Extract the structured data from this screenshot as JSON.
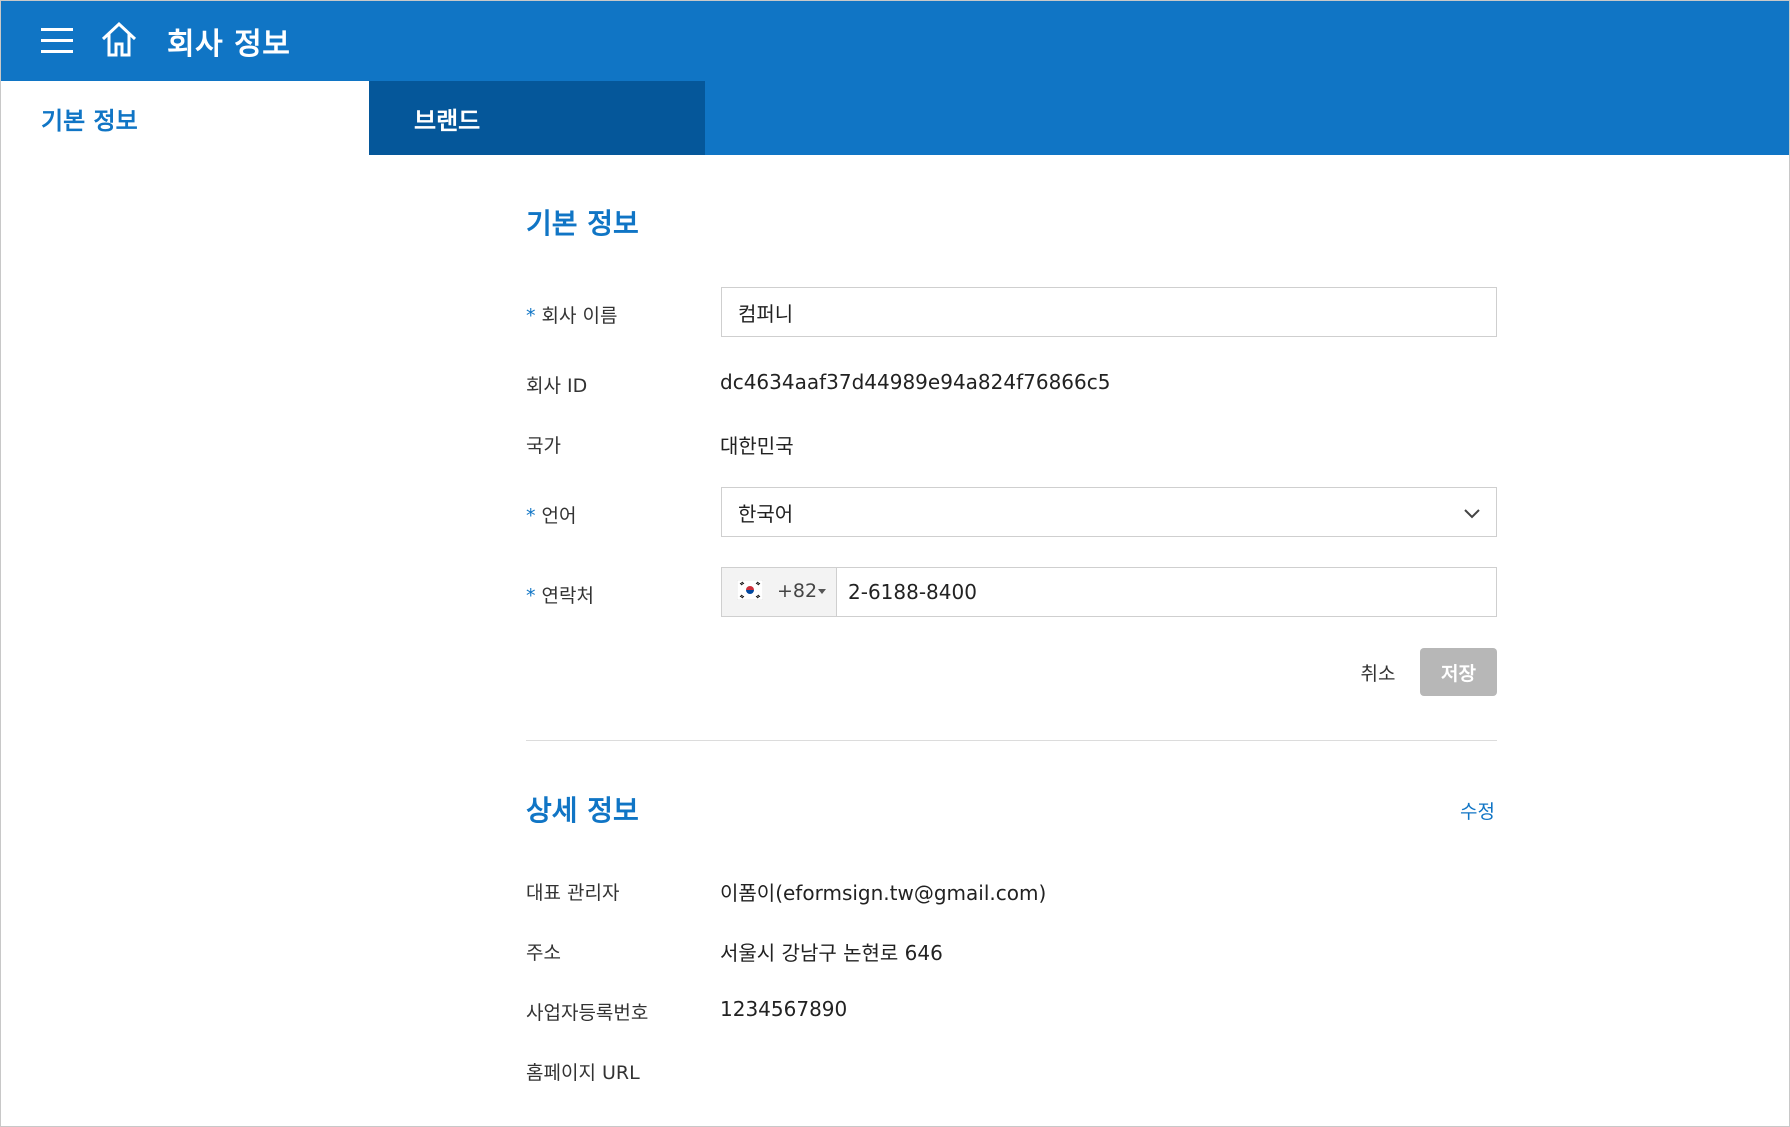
{
  "header": {
    "title": "회사 정보",
    "menu_icon": "hamburger-menu-icon",
    "home_icon": "home-icon"
  },
  "tabs": [
    {
      "label": "기본 정보",
      "active": true
    },
    {
      "label": "브랜드",
      "active": false
    }
  ],
  "basic_info": {
    "title": "기본 정보",
    "required_mark": "*",
    "company_name": {
      "label": "회사 이름",
      "value": "컴퍼니"
    },
    "company_id": {
      "label": "회사 ID",
      "value": "dc4634aaf37d44989e94a824f76866c5"
    },
    "country": {
      "label": "국가",
      "value": "대한민국"
    },
    "language": {
      "label": "언어",
      "value": "한국어"
    },
    "contact": {
      "label": "연락처",
      "country_code": "+82",
      "number": "2-6188-8400",
      "flag_icon": "korea-flag-icon"
    },
    "cancel_label": "취소",
    "save_label": "저장"
  },
  "detail_info": {
    "title": "상세 정보",
    "edit_label": "수정",
    "representative_admin": {
      "label": "대표 관리자",
      "value": "이폼이(eformsign.tw@gmail.com)"
    },
    "address": {
      "label": "주소",
      "value": "서울시 강남구 논현로 646"
    },
    "business_number": {
      "label": "사업자등록번호",
      "value": "1234567890"
    },
    "homepage_url": {
      "label": "홈페이지 URL",
      "value": ""
    }
  },
  "colors": {
    "primary": "#1075c5",
    "tab_dark": "#05579a",
    "save_disabled": "#b7b7b7"
  }
}
